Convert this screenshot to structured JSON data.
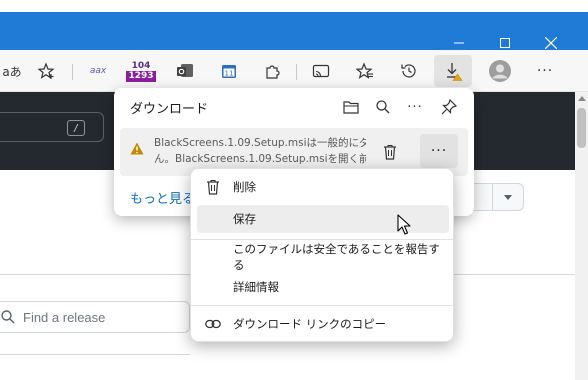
{
  "window": {
    "minimize_icon": "minimize-icon",
    "maximize_icon": "maximize-icon",
    "close_icon": "close-icon",
    "title_color": "#1f7bd6"
  },
  "toolbar": {
    "read_aloud_label": "aあ",
    "badge_top": "104",
    "badge_bottom": "1293",
    "ext_label": "aax"
  },
  "page": {
    "slash_key": "/",
    "find_release_placeholder": "Find a release"
  },
  "downloads": {
    "title": "ダウンロード",
    "item_line1": "BlackScreens.1.09.Setup.msiは一般的にダ",
    "item_line2": "ん。BlackScreens.1.09.Setup.msiを開く前",
    "more_label": "···",
    "see_more": "もっと見る",
    "warning_color": "#c08b00"
  },
  "context_menu": {
    "items": [
      {
        "label": "削除",
        "icon": "trash-icon"
      },
      {
        "label": "保存"
      },
      {
        "label": "このファイルは安全であることを報告する"
      },
      {
        "label": "詳細情報"
      },
      {
        "label": "ダウンロード リンクのコピー",
        "icon": "link-icon"
      }
    ],
    "hovered_item": "保存"
  }
}
